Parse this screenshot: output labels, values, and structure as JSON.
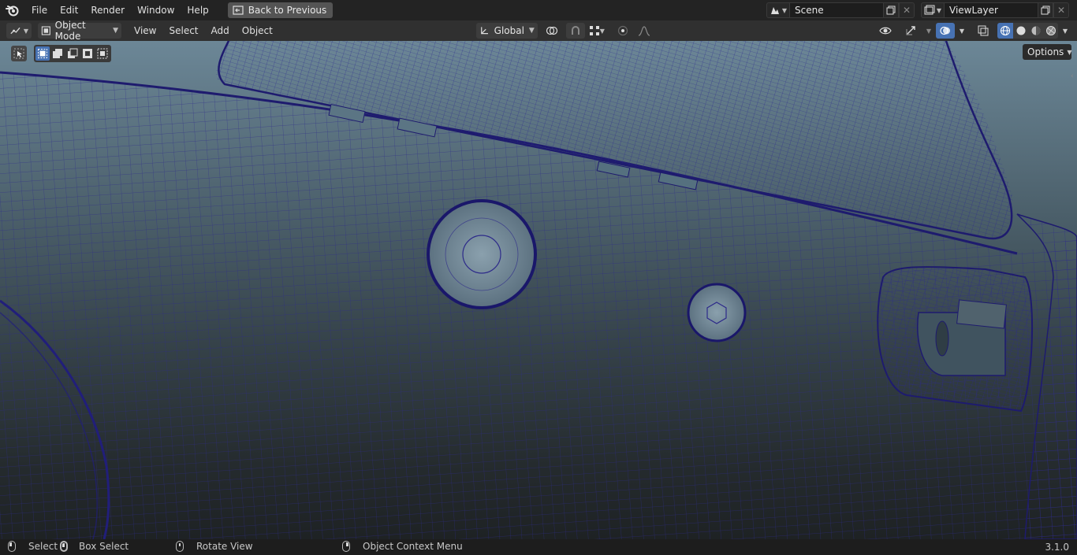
{
  "topbar": {
    "menus": [
      "File",
      "Edit",
      "Render",
      "Window",
      "Help"
    ],
    "back_label": "Back to Previous",
    "scene_name": "Scene",
    "view_layer": "ViewLayer"
  },
  "header": {
    "mode_label": "Object Mode",
    "menus": [
      "View",
      "Select",
      "Add",
      "Object"
    ],
    "transform_orientation": "Global"
  },
  "viewport": {
    "options_label": "Options"
  },
  "statusbar": {
    "select": "Select",
    "box_select": "Box Select",
    "rotate_view": "Rotate View",
    "context_menu": "Object Context Menu",
    "version": "3.1.0"
  },
  "colors": {
    "accent": "#4772b3",
    "wire": "#2d2a8a"
  },
  "icons": [
    "blender-logo-icon",
    "back-icon",
    "scene-icon",
    "view-layer-icon",
    "duplicate-icon",
    "close-icon",
    "editor-type-icon",
    "object-mode-icon",
    "orientation-icon",
    "pivot-icon",
    "snap-icon",
    "snap-grid-icon",
    "proportional-icon",
    "falloff-icon",
    "visibility-icon",
    "gizmo-icon",
    "overlay-icon",
    "xray-icon",
    "wireframe-shading-icon",
    "solid-shading-icon",
    "material-shading-icon",
    "rendered-shading-icon",
    "select-tool-icon",
    "mouse-icon"
  ]
}
